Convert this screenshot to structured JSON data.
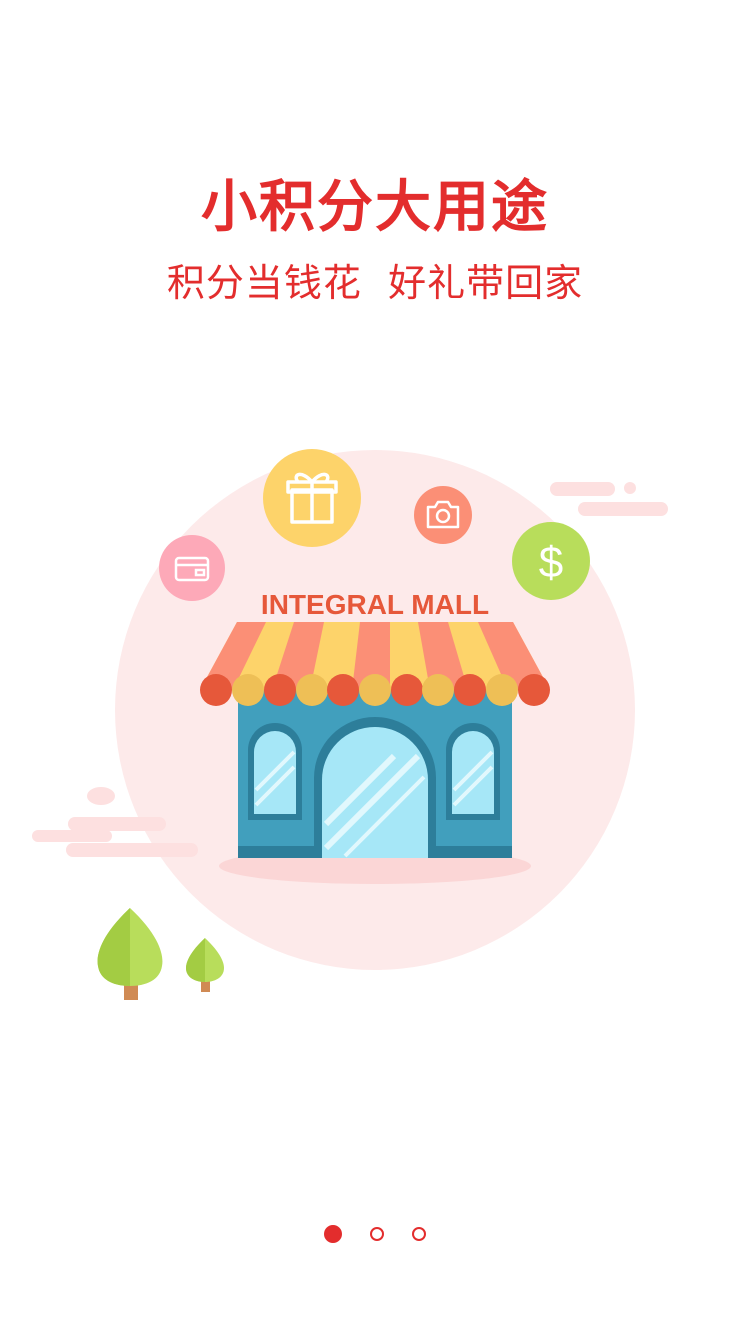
{
  "headline": "小积分大用途",
  "subline": "积分当钱花  好礼带回家",
  "store_sign": "INTEGRAL MALL",
  "icons": {
    "gift": "gift-icon",
    "wallet": "wallet-icon",
    "camera": "camera-icon",
    "dollar": "dollar-icon",
    "dollar_symbol": "$"
  },
  "pager": {
    "total": 3,
    "active_index": 0
  },
  "colors": {
    "accent": "#e32d2d",
    "bg_circle": "#fdeaea",
    "store_blue": "#419fbd",
    "glass": "#a6e7f7",
    "gift_circle": "#fdd36a",
    "wallet_circle": "#fda9b8",
    "camera_circle": "#fb8f76",
    "dollar_circle": "#b8dd5b"
  }
}
